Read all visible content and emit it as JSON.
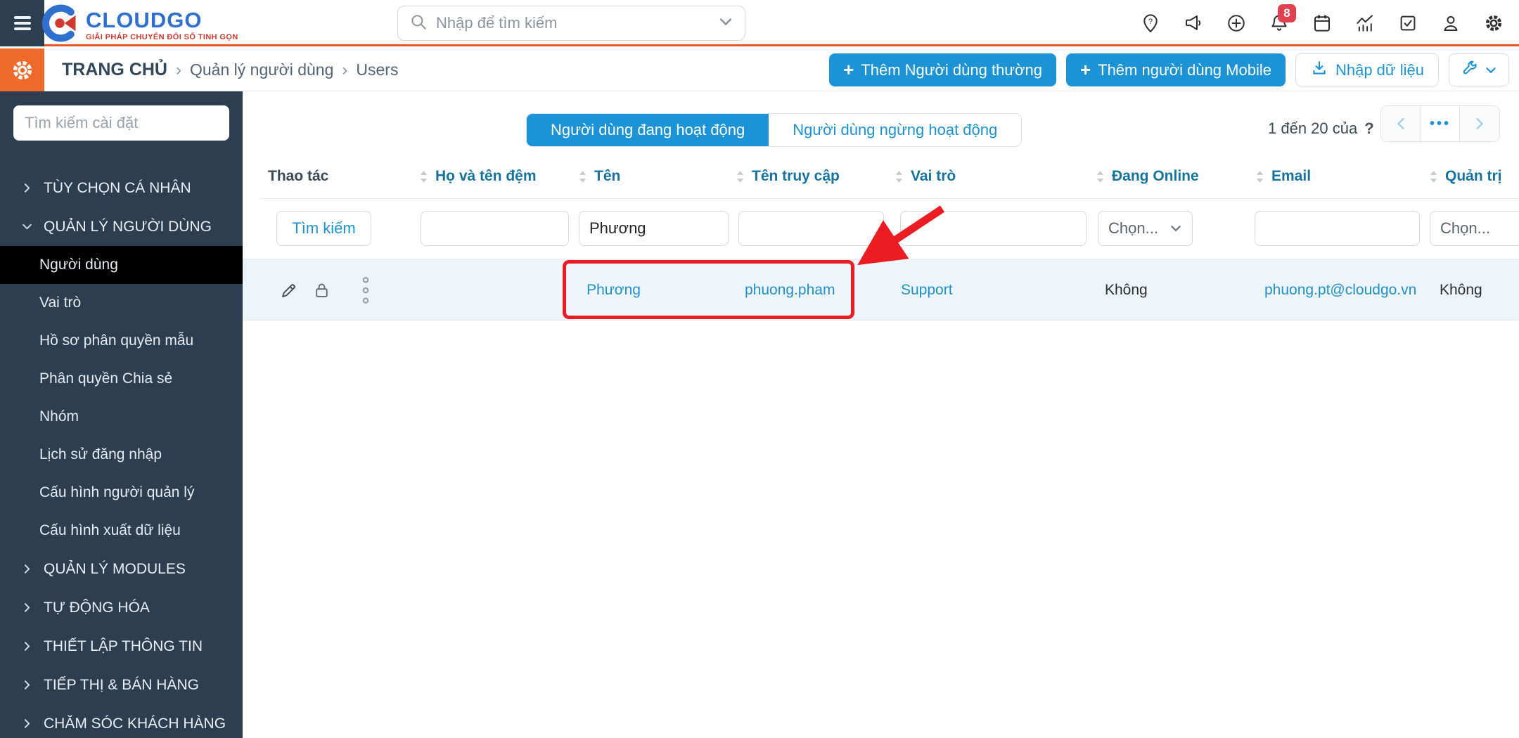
{
  "topbar": {
    "search_placeholder": "Nhập để tìm kiếm",
    "bell_badge": "8",
    "icons": [
      "location-pin-help",
      "megaphone",
      "plus-circle",
      "bell",
      "calendar",
      "chart",
      "task-check",
      "user",
      "gear"
    ]
  },
  "logo": {
    "name": "CLOUDGO",
    "tagline": "GIẢI PHÁP CHUYỂN ĐỔI SỐ TINH GỌN"
  },
  "breadcrumb": {
    "separator": "›",
    "items": [
      "TRANG CHỦ",
      "Quản lý người dùng",
      "Users"
    ]
  },
  "actions": {
    "add_user_label": "Thêm Người dùng thường",
    "add_mobile_label": "Thêm người dùng Mobile",
    "import_label": "Nhập dữ liệu"
  },
  "sidebar": {
    "search_placeholder": "Tìm kiếm cài đặt",
    "items": [
      {
        "label": "TÙY CHỌN CÁ NHÂN",
        "type": "section"
      },
      {
        "label": "QUẢN LÝ NGƯỜI DÙNG",
        "type": "section-open"
      },
      {
        "label": "Người dùng",
        "type": "child-selected"
      },
      {
        "label": "Vai trò",
        "type": "child"
      },
      {
        "label": "Hồ sơ phân quyền mẫu",
        "type": "child"
      },
      {
        "label": "Phân quyền Chia sẻ",
        "type": "child"
      },
      {
        "label": "Nhóm",
        "type": "child"
      },
      {
        "label": "Lịch sử đăng nhập",
        "type": "child"
      },
      {
        "label": "Cấu hình người quản lý",
        "type": "child"
      },
      {
        "label": "Cấu hình xuất dữ liệu",
        "type": "child"
      },
      {
        "label": "QUẢN LÝ MODULES",
        "type": "section"
      },
      {
        "label": "TỰ ĐỘNG HÓA",
        "type": "section"
      },
      {
        "label": "THIẾT LẬP THÔNG TIN",
        "type": "section"
      },
      {
        "label": "TIẾP THỊ & BÁN HÀNG",
        "type": "section"
      },
      {
        "label": "CHĂM SÓC KHÁCH HÀNG",
        "type": "section"
      }
    ]
  },
  "tabs": {
    "active_label": "Người dùng đang hoạt động",
    "inactive_label": "Người dùng ngừng hoạt động"
  },
  "pagination": {
    "range_label": "1 đến 20 của",
    "total": "?",
    "ellipsis": "•••"
  },
  "table": {
    "columns": [
      "Thao tác",
      "Họ và tên đệm",
      "Tên",
      "Tên truy cập",
      "Vai trò",
      "Đang Online",
      "Email",
      "Quản trị"
    ],
    "filter": {
      "search_label": "Tìm kiếm",
      "name_value": "Phương",
      "select_placeholder": "Chọn..."
    },
    "rows": [
      {
        "ho_ten_dem": "",
        "ten": "Phương",
        "ten_truy_cap": "phuong.pham",
        "vai_tro": "Support",
        "dang_online": "Không",
        "email": "phuong.pt@cloudgo.vn",
        "quan_tri": "Không"
      }
    ]
  },
  "colors": {
    "accent_blue": "#1b93d6",
    "link_blue": "#2191cc",
    "header_blue": "#15739e",
    "sidebar_dark": "#2d3e50",
    "orange_square": "#ed6a2b",
    "topbar_orange_line": "#e85a24",
    "annotation_red": "#ec1c24",
    "badge_red": "#e04050",
    "row_highlight": "#edf5fb",
    "selected_item_black": "#000000"
  }
}
